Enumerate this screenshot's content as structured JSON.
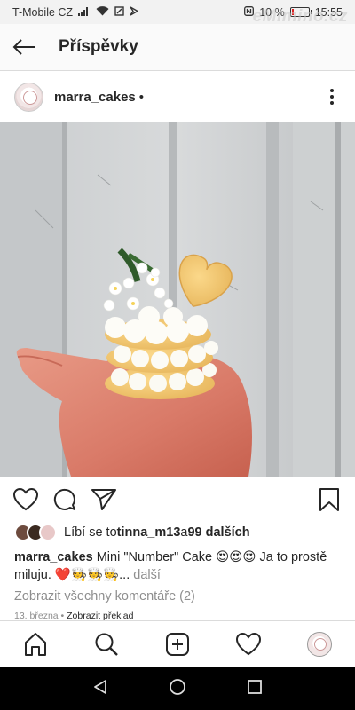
{
  "status_bar": {
    "carrier": "T-Mobile CZ",
    "battery": "10 %",
    "battery_level": 0.1,
    "time": "15:55",
    "watermark": "eMimino.cz"
  },
  "header": {
    "title": "Příspěvky"
  },
  "post": {
    "username": "marra_cakes",
    "username_suffix": "•",
    "likes": {
      "prefix": "Líbí se to ",
      "user": "tinna_m13",
      "middle": " a ",
      "count": "99 dalších"
    },
    "caption": {
      "username": "marra_cakes",
      "text": " Mini \"Number\" Cake 😍😍😍 Ja to prostě miluju. ❤️🧑‍🍳🧑‍🍳🧑‍🍳...",
      "more": " další"
    },
    "comments_link": "Zobrazit všechny komentáře (2)",
    "date": "13. března",
    "translate": "Zobrazit překlad"
  },
  "colors": {
    "text": "#262626",
    "muted": "#8e8e8e",
    "divider": "#dbdbdb"
  }
}
